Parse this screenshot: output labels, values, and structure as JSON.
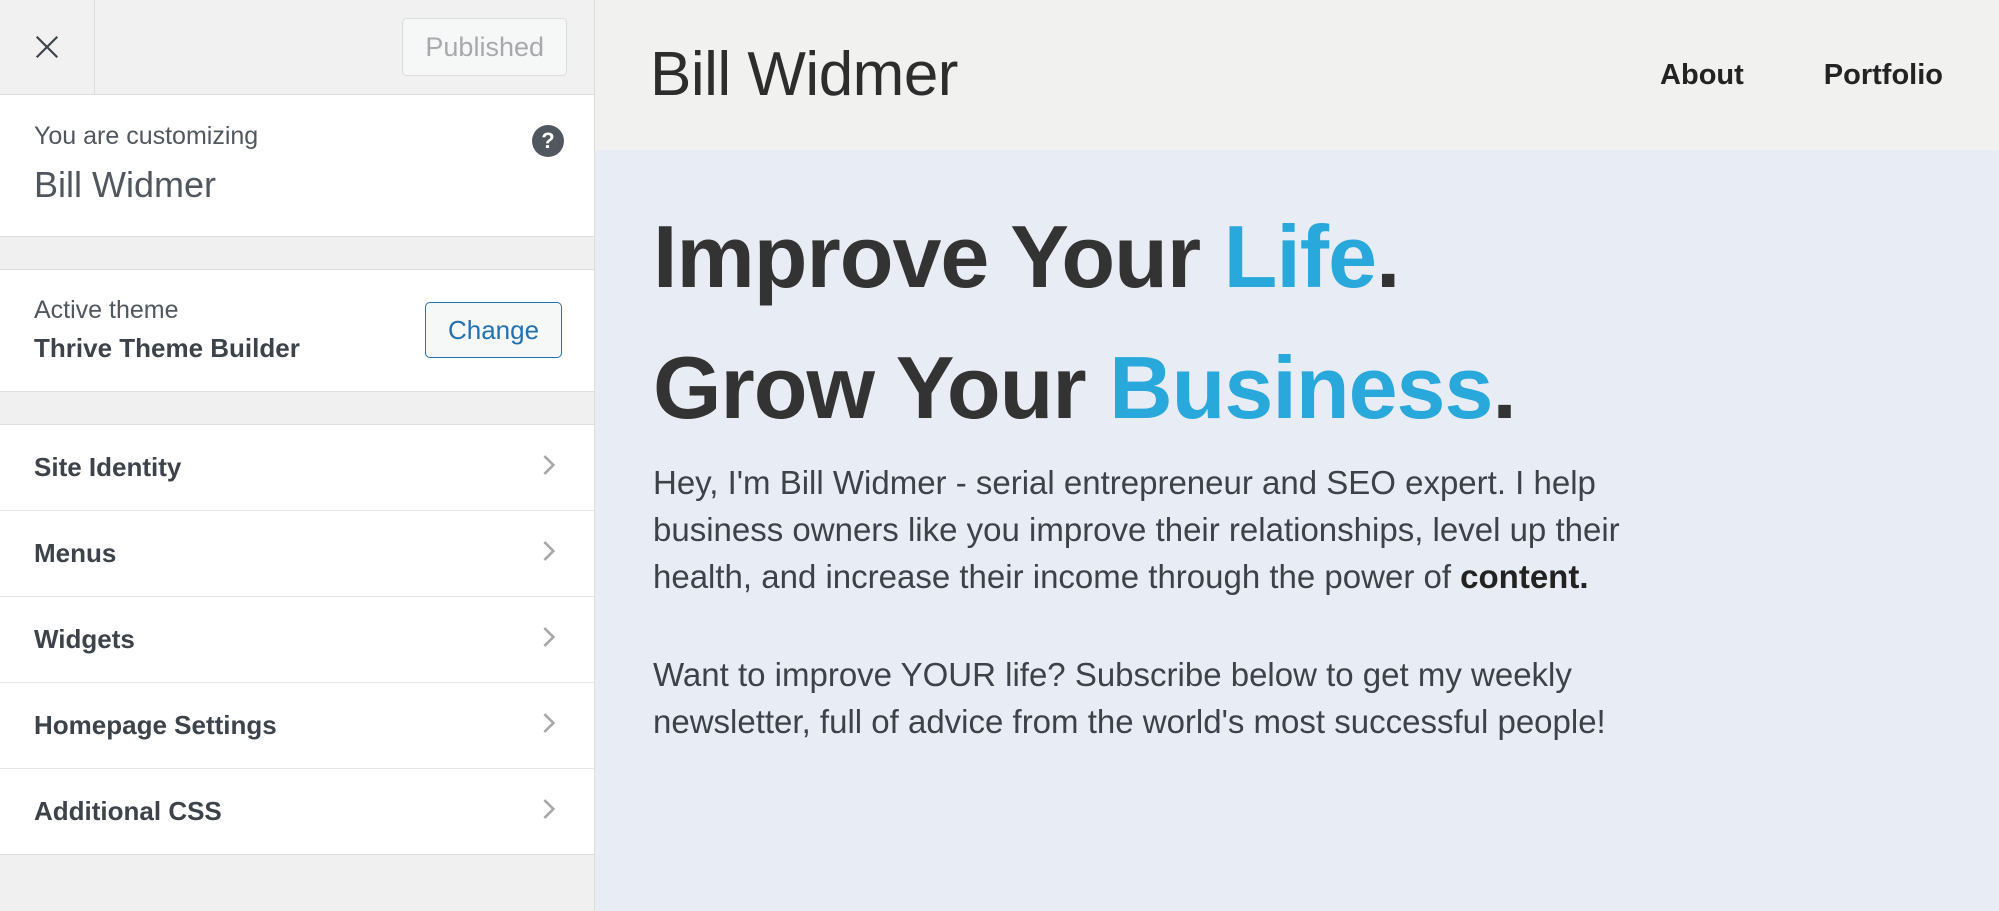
{
  "customizer": {
    "close_icon": "close-x-icon",
    "publish_button": "Published",
    "header": {
      "eyebrow": "You are customizing",
      "site_name": "Bill Widmer",
      "help_icon": "?"
    },
    "theme": {
      "label": "Active theme",
      "name": "Thrive Theme Builder",
      "change_button": "Change"
    },
    "panels": [
      {
        "label": "Site Identity",
        "chevron": "chevron-right-icon"
      },
      {
        "label": "Menus",
        "chevron": "chevron-right-icon"
      },
      {
        "label": "Widgets",
        "chevron": "chevron-right-icon"
      },
      {
        "label": "Homepage Settings",
        "chevron": "chevron-right-icon"
      },
      {
        "label": "Additional CSS",
        "chevron": "chevron-right-icon"
      }
    ]
  },
  "preview": {
    "site_title": "Bill Widmer",
    "nav": [
      {
        "label": "About"
      },
      {
        "label": "Portfolio"
      }
    ],
    "hero": {
      "line1_plain": "Improve Your ",
      "line1_accent": "Life",
      "line1_period": ".",
      "line2_plain": "Grow Your ",
      "line2_accent": "Business",
      "line2_period": ".",
      "paragraph1_pre": "Hey, I'm Bill Widmer - serial entrepreneur and SEO expert. I help business owners like you improve their relationships, level up their health, and increase their income through the power of ",
      "paragraph1_bold": "content.",
      "paragraph2": "Want to improve YOUR life? Subscribe below to get my weekly newsletter, full of advice from the world's most successful people!"
    }
  },
  "colors": {
    "accent_blue": "#29a8dc",
    "heading_dark": "#333333",
    "sidebar_bg": "#ffffff",
    "topbar_bg": "#f1f1f1",
    "hero_bg": "#e8ecf4",
    "site_header_bg": "#f1f1f0",
    "link_blue": "#2271b1"
  }
}
